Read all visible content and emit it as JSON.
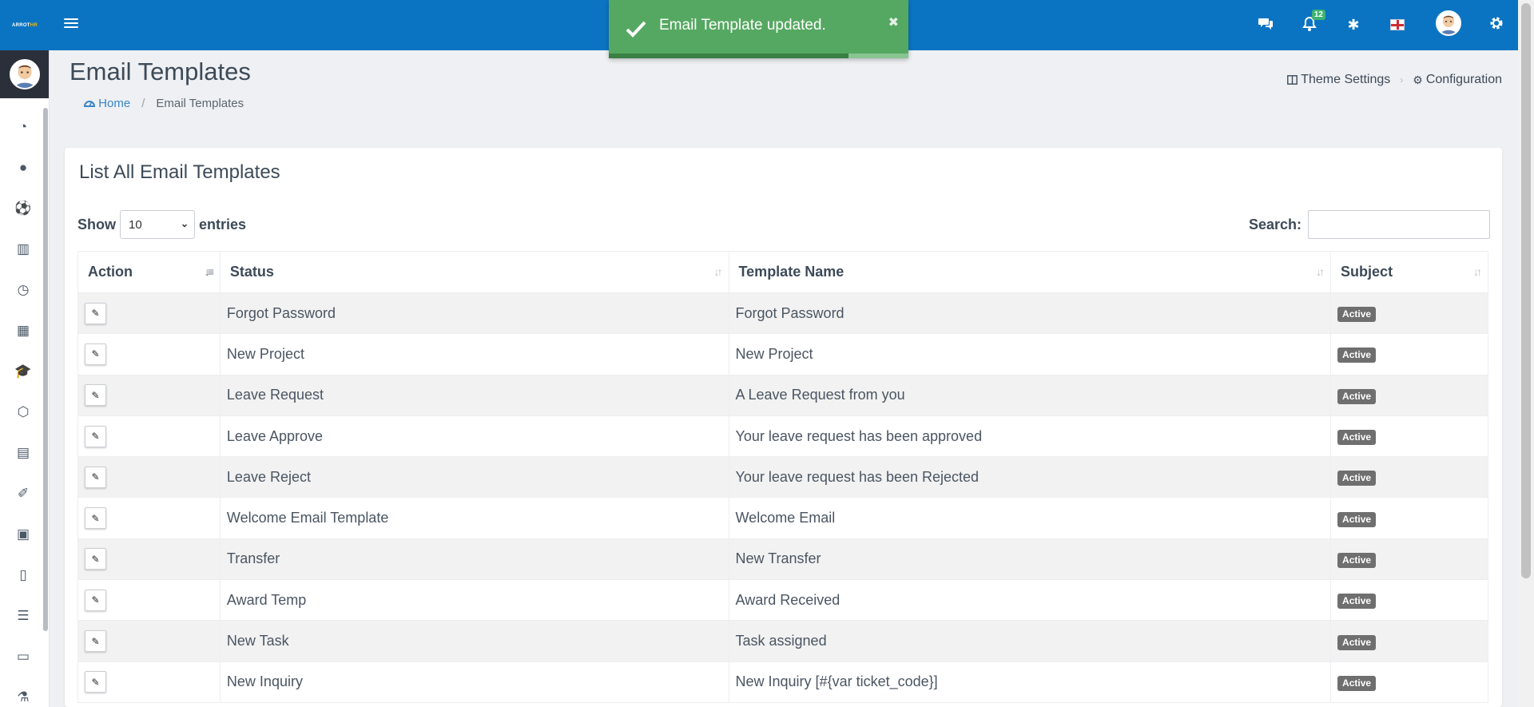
{
  "header": {
    "logo_text": "ARROT",
    "logo_accent": "HR",
    "notifications_count": "12",
    "icons": [
      "chat-icon",
      "bell-icon",
      "asterisk-icon",
      "flag-icon",
      "avatar",
      "gear-icon"
    ]
  },
  "toast": {
    "message": "Email Template updated.",
    "progress": 0.8
  },
  "page": {
    "title": "Email Templates",
    "breadcrumb": {
      "home": "Home",
      "current": "Email Templates"
    },
    "links": {
      "theme_settings": "Theme Settings",
      "configuration": "Configuration"
    }
  },
  "card": {
    "title": "List All Email Templates",
    "length": {
      "show_label": "Show",
      "value": "10",
      "entries_label": "entries"
    },
    "search_label": "Search:",
    "search_value": "",
    "columns": [
      "Action",
      "Status",
      "Template Name",
      "Subject"
    ],
    "rows": [
      {
        "status": "Forgot Password",
        "template_name": "Forgot Password",
        "subject": "Active"
      },
      {
        "status": "New Project",
        "template_name": "New Project",
        "subject": "Active"
      },
      {
        "status": "Leave Request",
        "template_name": "A Leave Request from you",
        "subject": "Active"
      },
      {
        "status": "Leave Approve",
        "template_name": "Your leave request has been approved",
        "subject": "Active"
      },
      {
        "status": "Leave Reject",
        "template_name": "Your leave request has been Rejected",
        "subject": "Active"
      },
      {
        "status": "Welcome Email Template",
        "template_name": "Welcome Email",
        "subject": "Active"
      },
      {
        "status": "Transfer",
        "template_name": "New Transfer",
        "subject": "Active"
      },
      {
        "status": "Award Temp",
        "template_name": "Award Received",
        "subject": "Active"
      },
      {
        "status": "New Task",
        "template_name": "Task assigned",
        "subject": "Active"
      },
      {
        "status": "New Inquiry",
        "template_name": "New Inquiry [#{var ticket_code}]",
        "subject": "Active"
      }
    ]
  },
  "sidebar": {
    "icons": [
      "dashboard-icon",
      "user-icon",
      "soccer-ball-icon",
      "building-icon",
      "clock-icon",
      "calculator-icon",
      "graduation-cap-icon",
      "box-icon",
      "calendar-icon",
      "ticket-icon",
      "newspaper-icon",
      "document-icon",
      "list-icon",
      "money-icon",
      "flask-icon"
    ]
  },
  "colors": {
    "header_bg": "#0a74c2",
    "toast_bg": "#55a861",
    "badge_bg": "#6f6f6f",
    "link": "#3a86c8"
  }
}
